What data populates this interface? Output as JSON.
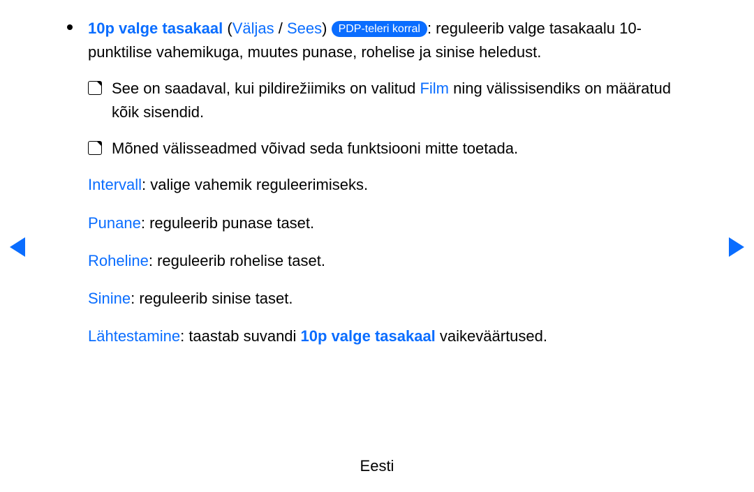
{
  "bullet": {
    "title": "10p valge tasakaal",
    "paren_open": " (",
    "opt_off": "Väljas",
    "slash": " / ",
    "opt_on": "Sees",
    "paren_close": ") ",
    "badge": "PDP-teleri korral",
    "desc": ": reguleerib valge tasakaalu 10-punktilise vahemikuga, muutes punase, rohelise ja sinise heledust."
  },
  "notes": [
    {
      "pre": "See on saadaval, kui pildirežiimiks on valitud ",
      "term": "Film",
      "post": " ning välissisendiks on määratud kõik sisendid."
    },
    {
      "pre": "Mõned välisseadmed võivad seda funktsiooni mitte toetada.",
      "term": "",
      "post": ""
    }
  ],
  "defs": [
    {
      "label": "Intervall",
      "text": ": valige vahemik reguleerimiseks."
    },
    {
      "label": "Punane",
      "text": ": reguleerib punase taset."
    },
    {
      "label": "Roheline",
      "text": ": reguleerib rohelise taset."
    },
    {
      "label": "Sinine",
      "text": ": reguleerib sinise taset."
    }
  ],
  "reset": {
    "label": "Lähtestamine",
    "mid": ": taastab suvandi ",
    "term": "10p valge tasakaal",
    "post": " vaikeväärtused."
  },
  "footer": "Eesti"
}
